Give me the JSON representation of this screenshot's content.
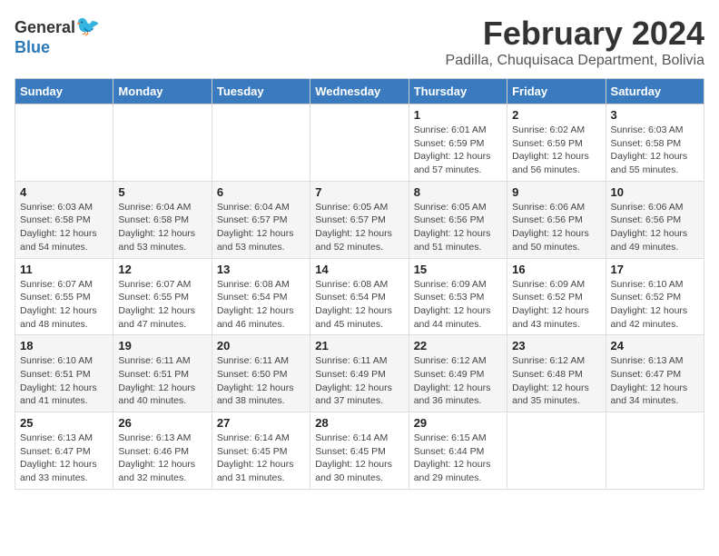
{
  "header": {
    "logo_general": "General",
    "logo_blue": "Blue",
    "title": "February 2024",
    "subtitle": "Padilla, Chuquisaca Department, Bolivia"
  },
  "days_of_week": [
    "Sunday",
    "Monday",
    "Tuesday",
    "Wednesday",
    "Thursday",
    "Friday",
    "Saturday"
  ],
  "weeks": [
    [
      {
        "day": "",
        "info": ""
      },
      {
        "day": "",
        "info": ""
      },
      {
        "day": "",
        "info": ""
      },
      {
        "day": "",
        "info": ""
      },
      {
        "day": "1",
        "info": "Sunrise: 6:01 AM\nSunset: 6:59 PM\nDaylight: 12 hours and 57 minutes."
      },
      {
        "day": "2",
        "info": "Sunrise: 6:02 AM\nSunset: 6:59 PM\nDaylight: 12 hours and 56 minutes."
      },
      {
        "day": "3",
        "info": "Sunrise: 6:03 AM\nSunset: 6:58 PM\nDaylight: 12 hours and 55 minutes."
      }
    ],
    [
      {
        "day": "4",
        "info": "Sunrise: 6:03 AM\nSunset: 6:58 PM\nDaylight: 12 hours and 54 minutes."
      },
      {
        "day": "5",
        "info": "Sunrise: 6:04 AM\nSunset: 6:58 PM\nDaylight: 12 hours and 53 minutes."
      },
      {
        "day": "6",
        "info": "Sunrise: 6:04 AM\nSunset: 6:57 PM\nDaylight: 12 hours and 53 minutes."
      },
      {
        "day": "7",
        "info": "Sunrise: 6:05 AM\nSunset: 6:57 PM\nDaylight: 12 hours and 52 minutes."
      },
      {
        "day": "8",
        "info": "Sunrise: 6:05 AM\nSunset: 6:56 PM\nDaylight: 12 hours and 51 minutes."
      },
      {
        "day": "9",
        "info": "Sunrise: 6:06 AM\nSunset: 6:56 PM\nDaylight: 12 hours and 50 minutes."
      },
      {
        "day": "10",
        "info": "Sunrise: 6:06 AM\nSunset: 6:56 PM\nDaylight: 12 hours and 49 minutes."
      }
    ],
    [
      {
        "day": "11",
        "info": "Sunrise: 6:07 AM\nSunset: 6:55 PM\nDaylight: 12 hours and 48 minutes."
      },
      {
        "day": "12",
        "info": "Sunrise: 6:07 AM\nSunset: 6:55 PM\nDaylight: 12 hours and 47 minutes."
      },
      {
        "day": "13",
        "info": "Sunrise: 6:08 AM\nSunset: 6:54 PM\nDaylight: 12 hours and 46 minutes."
      },
      {
        "day": "14",
        "info": "Sunrise: 6:08 AM\nSunset: 6:54 PM\nDaylight: 12 hours and 45 minutes."
      },
      {
        "day": "15",
        "info": "Sunrise: 6:09 AM\nSunset: 6:53 PM\nDaylight: 12 hours and 44 minutes."
      },
      {
        "day": "16",
        "info": "Sunrise: 6:09 AM\nSunset: 6:52 PM\nDaylight: 12 hours and 43 minutes."
      },
      {
        "day": "17",
        "info": "Sunrise: 6:10 AM\nSunset: 6:52 PM\nDaylight: 12 hours and 42 minutes."
      }
    ],
    [
      {
        "day": "18",
        "info": "Sunrise: 6:10 AM\nSunset: 6:51 PM\nDaylight: 12 hours and 41 minutes."
      },
      {
        "day": "19",
        "info": "Sunrise: 6:11 AM\nSunset: 6:51 PM\nDaylight: 12 hours and 40 minutes."
      },
      {
        "day": "20",
        "info": "Sunrise: 6:11 AM\nSunset: 6:50 PM\nDaylight: 12 hours and 38 minutes."
      },
      {
        "day": "21",
        "info": "Sunrise: 6:11 AM\nSunset: 6:49 PM\nDaylight: 12 hours and 37 minutes."
      },
      {
        "day": "22",
        "info": "Sunrise: 6:12 AM\nSunset: 6:49 PM\nDaylight: 12 hours and 36 minutes."
      },
      {
        "day": "23",
        "info": "Sunrise: 6:12 AM\nSunset: 6:48 PM\nDaylight: 12 hours and 35 minutes."
      },
      {
        "day": "24",
        "info": "Sunrise: 6:13 AM\nSunset: 6:47 PM\nDaylight: 12 hours and 34 minutes."
      }
    ],
    [
      {
        "day": "25",
        "info": "Sunrise: 6:13 AM\nSunset: 6:47 PM\nDaylight: 12 hours and 33 minutes."
      },
      {
        "day": "26",
        "info": "Sunrise: 6:13 AM\nSunset: 6:46 PM\nDaylight: 12 hours and 32 minutes."
      },
      {
        "day": "27",
        "info": "Sunrise: 6:14 AM\nSunset: 6:45 PM\nDaylight: 12 hours and 31 minutes."
      },
      {
        "day": "28",
        "info": "Sunrise: 6:14 AM\nSunset: 6:45 PM\nDaylight: 12 hours and 30 minutes."
      },
      {
        "day": "29",
        "info": "Sunrise: 6:15 AM\nSunset: 6:44 PM\nDaylight: 12 hours and 29 minutes."
      },
      {
        "day": "",
        "info": ""
      },
      {
        "day": "",
        "info": ""
      }
    ]
  ]
}
